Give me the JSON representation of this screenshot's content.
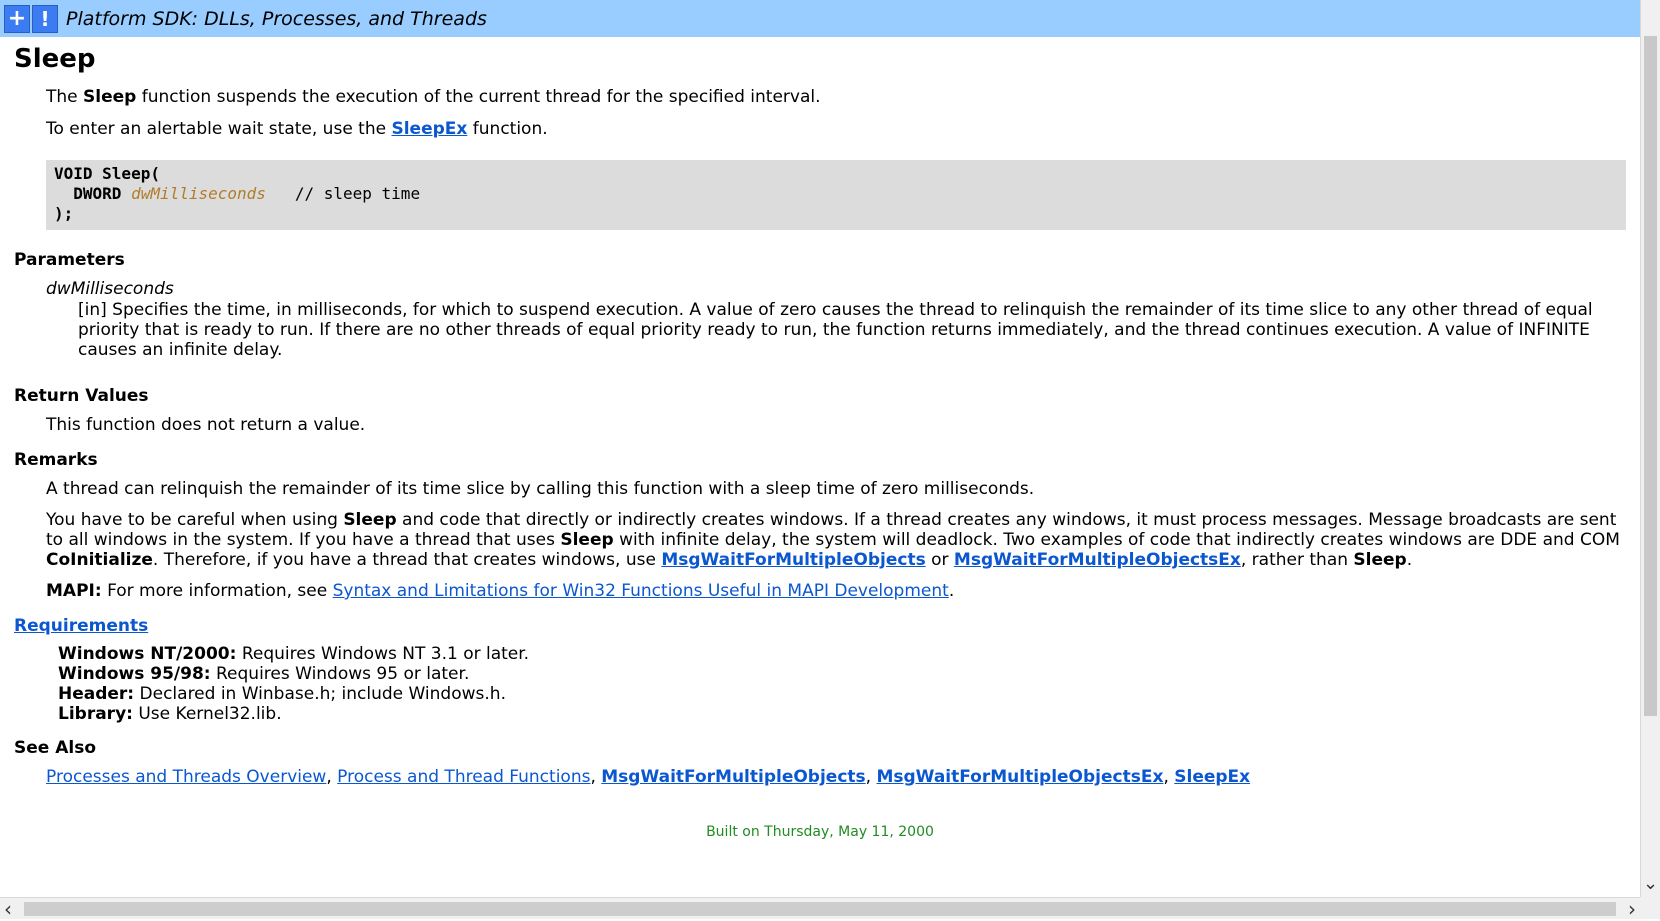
{
  "banner": {
    "plus_icon": "+",
    "excl_icon": "!",
    "title": "Platform SDK: DLLs, Processes, and Threads"
  },
  "page": {
    "title": "Sleep",
    "intro": {
      "p1_pre": "The ",
      "p1_bold": "Sleep",
      "p1_post": " function suspends the execution of the current thread for the specified interval.",
      "p2_pre": "To enter an alertable wait state, use the ",
      "p2_link": "SleepEx",
      "p2_post": " function."
    },
    "syntax": {
      "line1": "VOID Sleep(",
      "type": "DWORD",
      "param": "dwMilliseconds",
      "comment": "// sleep time",
      "line3": ");"
    },
    "parameters": {
      "heading": "Parameters",
      "name": "dwMilliseconds",
      "desc": "[in] Specifies the time, in milliseconds, for which to suspend execution. A value of zero causes the thread to relinquish the remainder of its time slice to any other thread of equal priority that is ready to run. If there are no other threads of equal priority ready to run, the function returns immediately, and the thread continues execution. A value of INFINITE causes an infinite delay."
    },
    "return_values": {
      "heading": "Return Values",
      "text": "This function does not return a value."
    },
    "remarks": {
      "heading": "Remarks",
      "p1": "A thread can relinquish the remainder of its time slice by calling this function with a sleep time of zero milliseconds.",
      "p2_a": "You have to be careful when using ",
      "p2_b": "Sleep",
      "p2_c": " and code that directly or indirectly creates windows. If a thread creates any windows, it must process messages. Message broadcasts are sent to all windows in the system. If you have a thread that uses ",
      "p2_d": "Sleep",
      "p2_e": " with infinite delay, the system will deadlock. Two examples of code that indirectly creates windows are DDE and COM ",
      "p2_f": "CoInitialize",
      "p2_g": ". Therefore, if you have a thread that creates windows, use ",
      "p2_link1": "MsgWaitForMultipleObjects",
      "p2_h": " or ",
      "p2_link2": "MsgWaitForMultipleObjectsEx",
      "p2_i": ", rather than ",
      "p2_j": "Sleep",
      "p2_k": ".",
      "mapi_label": "MAPI:",
      "mapi_pre": " For more information, see ",
      "mapi_link": "Syntax and Limitations for Win32 Functions Useful in MAPI Development",
      "mapi_post": "."
    },
    "requirements": {
      "heading": "Requirements",
      "rows": [
        {
          "label": "Windows NT/2000:",
          "value": " Requires Windows NT 3.1 or later."
        },
        {
          "label": "Windows 95/98:",
          "value": " Requires Windows 95 or later."
        },
        {
          "label": "Header:",
          "value": " Declared in Winbase.h; include Windows.h."
        },
        {
          "label": "Library:",
          "value": " Use Kernel32.lib."
        }
      ]
    },
    "see_also": {
      "heading": "See Also",
      "links": [
        "Processes and Threads Overview",
        "Process and Thread Functions",
        "MsgWaitForMultipleObjects",
        "MsgWaitForMultipleObjectsEx",
        "SleepEx"
      ],
      "sep": ", "
    },
    "footer": "Built on Thursday, May 11, 2000"
  },
  "scrollbars": {
    "left_arrow": "‹",
    "right_arrow": "›",
    "down_arrow": "⌄"
  }
}
